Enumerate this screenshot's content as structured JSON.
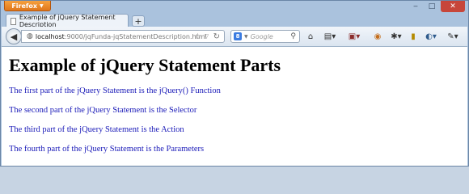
{
  "browser": {
    "app_button_label": "Firefox",
    "tab_title": "Example of jQuery Statement Description",
    "new_tab_label": "+",
    "url_host": "localhost",
    "url_path": ":9000/jqFunda-jqStatementDescription.html",
    "search_placeholder": "Google",
    "search_engine_letter": "8",
    "accent_color": "#e0761a"
  },
  "page": {
    "heading": "Example of jQuery Statement Parts",
    "lines": [
      "The first part of the jQuery Statement is the jQuery() Function",
      "The second part of the jQuery Statement is the Selector",
      "The third part of the jQuery Statement is the Action",
      "The fourth part of the jQuery Statement is the Parameters"
    ],
    "text_color": "#1a1ab8"
  }
}
